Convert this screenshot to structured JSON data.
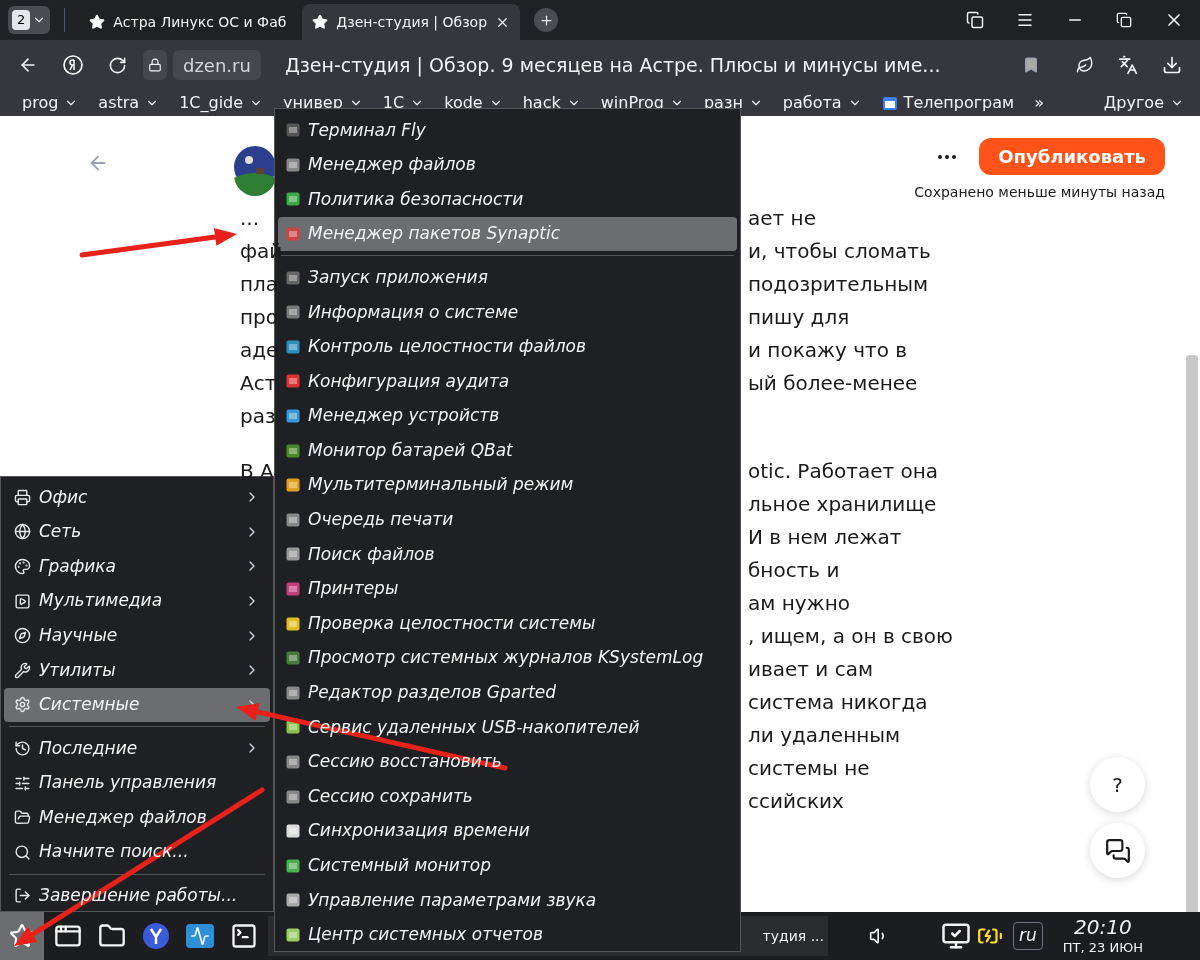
{
  "browser": {
    "tab_count": "2",
    "tabs": [
      {
        "title": "Астра Линукс ОС и Фаб",
        "selected": false
      },
      {
        "title": "Дзен-студия | Обзор",
        "selected": true
      }
    ],
    "domain": "dzen.ru",
    "page_title": "Дзен-студия | Обзор. 9 месяцев на Астре. Плюсы и минусы име...",
    "bookmarks": [
      {
        "label": "prog",
        "kind": "folder"
      },
      {
        "label": "astra",
        "kind": "folder"
      },
      {
        "label": "1C_gide",
        "kind": "folder"
      },
      {
        "label": "универ",
        "kind": "folder"
      },
      {
        "label": "1С",
        "kind": "folder"
      },
      {
        "label": "kode",
        "kind": "folder"
      },
      {
        "label": "hack",
        "kind": "folder"
      },
      {
        "label": "winProg",
        "kind": "folder"
      },
      {
        "label": "разн",
        "kind": "folder"
      },
      {
        "label": "работа",
        "kind": "folder"
      },
      {
        "label": "Телепрограм",
        "kind": "link"
      },
      {
        "label": "»",
        "kind": "overflow"
      },
      {
        "label": "Другое",
        "kind": "folder"
      }
    ]
  },
  "editor": {
    "publish_button": "Опубликовать",
    "save_status": "Сохранено меньше минуты назад",
    "help_button": "?"
  },
  "article": {
    "paragraphs": [
      [
        {
          "left": "...",
          "right": "ает не"
        },
        {
          "left": "фай",
          "right": "и, чтобы сломать"
        },
        {
          "left": "пла",
          "right": "подозрительным"
        },
        {
          "left": "про",
          "right": "пишу для"
        },
        {
          "left": "аде",
          "right": "и покажу что в"
        },
        {
          "left": "Аст",
          "right": "ый более-менее"
        },
        {
          "left": "раз"
        }
      ],
      [
        {
          "left": "В А",
          "right": "otic. Работает она"
        },
        {
          "right": "льное хранилище"
        },
        {
          "right": "И в нем лежат"
        },
        {
          "right": "бность и"
        },
        {
          "right": "ам нужно"
        },
        {
          "right": ", ищем, а он в свою"
        },
        {
          "right": "ивает и сам"
        },
        {
          "right": "система никогда"
        },
        {
          "right": "ли удаленным"
        },
        {
          "right": "системы не"
        },
        {
          "right": "ссийских"
        }
      ]
    ]
  },
  "start_menu": {
    "items": [
      {
        "kind": "category",
        "label": "Офис",
        "selected": false
      },
      {
        "kind": "category",
        "label": "Сеть",
        "selected": false
      },
      {
        "kind": "category",
        "label": "Графика",
        "selected": false
      },
      {
        "kind": "category",
        "label": "Мультимедиа",
        "selected": false
      },
      {
        "kind": "category",
        "label": "Научные",
        "selected": false
      },
      {
        "kind": "category",
        "label": "Утилиты",
        "selected": false
      },
      {
        "kind": "category",
        "label": "Системные",
        "selected": true
      },
      {
        "kind": "separator"
      },
      {
        "kind": "category",
        "label": "Последние",
        "selected": false
      },
      {
        "kind": "item",
        "label": "Панель управления",
        "selected": false
      },
      {
        "kind": "item",
        "label": "Менеджер файлов",
        "selected": false
      },
      {
        "kind": "item",
        "label": "Начните поиск...",
        "selected": false
      },
      {
        "kind": "separator"
      },
      {
        "kind": "item",
        "label": "Завершение работы...",
        "selected": false
      }
    ]
  },
  "submenu": {
    "items": [
      {
        "kind": "item",
        "label": "Терминал Fly",
        "selected": false
      },
      {
        "kind": "item",
        "label": "Менеджер файлов",
        "selected": false
      },
      {
        "kind": "item",
        "label": "Политика безопасности",
        "selected": false
      },
      {
        "kind": "item",
        "label": "Менеджер пакетов Synaptic",
        "selected": true
      },
      {
        "kind": "separator"
      },
      {
        "kind": "item",
        "label": "Запуск приложения",
        "selected": false
      },
      {
        "kind": "item",
        "label": "Информация о системе",
        "selected": false
      },
      {
        "kind": "item",
        "label": "Контроль целостности файлов",
        "selected": false
      },
      {
        "kind": "item",
        "label": "Конфигурация аудита",
        "selected": false
      },
      {
        "kind": "item",
        "label": "Менеджер устройств",
        "selected": false
      },
      {
        "kind": "item",
        "label": "Монитор батарей QBat",
        "selected": false
      },
      {
        "kind": "item",
        "label": "Мультитерминальный режим",
        "selected": false
      },
      {
        "kind": "item",
        "label": "Очередь печати",
        "selected": false
      },
      {
        "kind": "item",
        "label": "Поиск файлов",
        "selected": false
      },
      {
        "kind": "item",
        "label": "Принтеры",
        "selected": false
      },
      {
        "kind": "item",
        "label": "Проверка целостности системы",
        "selected": false
      },
      {
        "kind": "item",
        "label": "Просмотр системных журналов KSystemLog",
        "selected": false
      },
      {
        "kind": "item",
        "label": "Редактор разделов Gparted",
        "selected": false
      },
      {
        "kind": "item",
        "label": "Сервис удаленных USB-накопителей",
        "selected": false
      },
      {
        "kind": "item",
        "label": "Сессию восстановить",
        "selected": false
      },
      {
        "kind": "item",
        "label": "Сессию сохранить",
        "selected": false
      },
      {
        "kind": "item",
        "label": "Синхронизация времени",
        "selected": false
      },
      {
        "kind": "item",
        "label": "Системный монитор",
        "selected": false
      },
      {
        "kind": "item",
        "label": "Управление параметрами звука",
        "selected": false
      },
      {
        "kind": "item",
        "label": "Центр системных отчетов",
        "selected": false
      }
    ]
  },
  "taskbar": {
    "window_title": "тудия ...",
    "language": "ru",
    "time": "20:10",
    "date": "ПТ, 23 ИЮН"
  }
}
